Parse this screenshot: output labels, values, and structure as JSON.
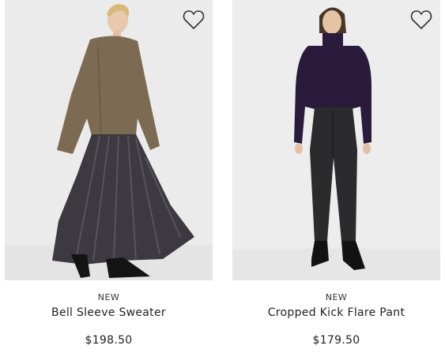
{
  "products": [
    {
      "badge": "NEW",
      "name": "Bell Sleeve Sweater",
      "price": "$198.50",
      "image_icon": "model-in-sweater-and-pleated-skirt",
      "favorite_icon": "heart-outline-icon"
    },
    {
      "badge": "NEW",
      "name": "Cropped Kick Flare Pant",
      "price": "$179.50",
      "image_icon": "model-in-turtleneck-and-flare-pants",
      "favorite_icon": "heart-outline-icon"
    }
  ],
  "colors": {
    "photo_background": "#ececec",
    "sweater": "#7d6a52",
    "skirt": "#3c3a40",
    "turtleneck": "#2a1b3d",
    "pants": "#2b2b2d",
    "text": "#222222"
  }
}
